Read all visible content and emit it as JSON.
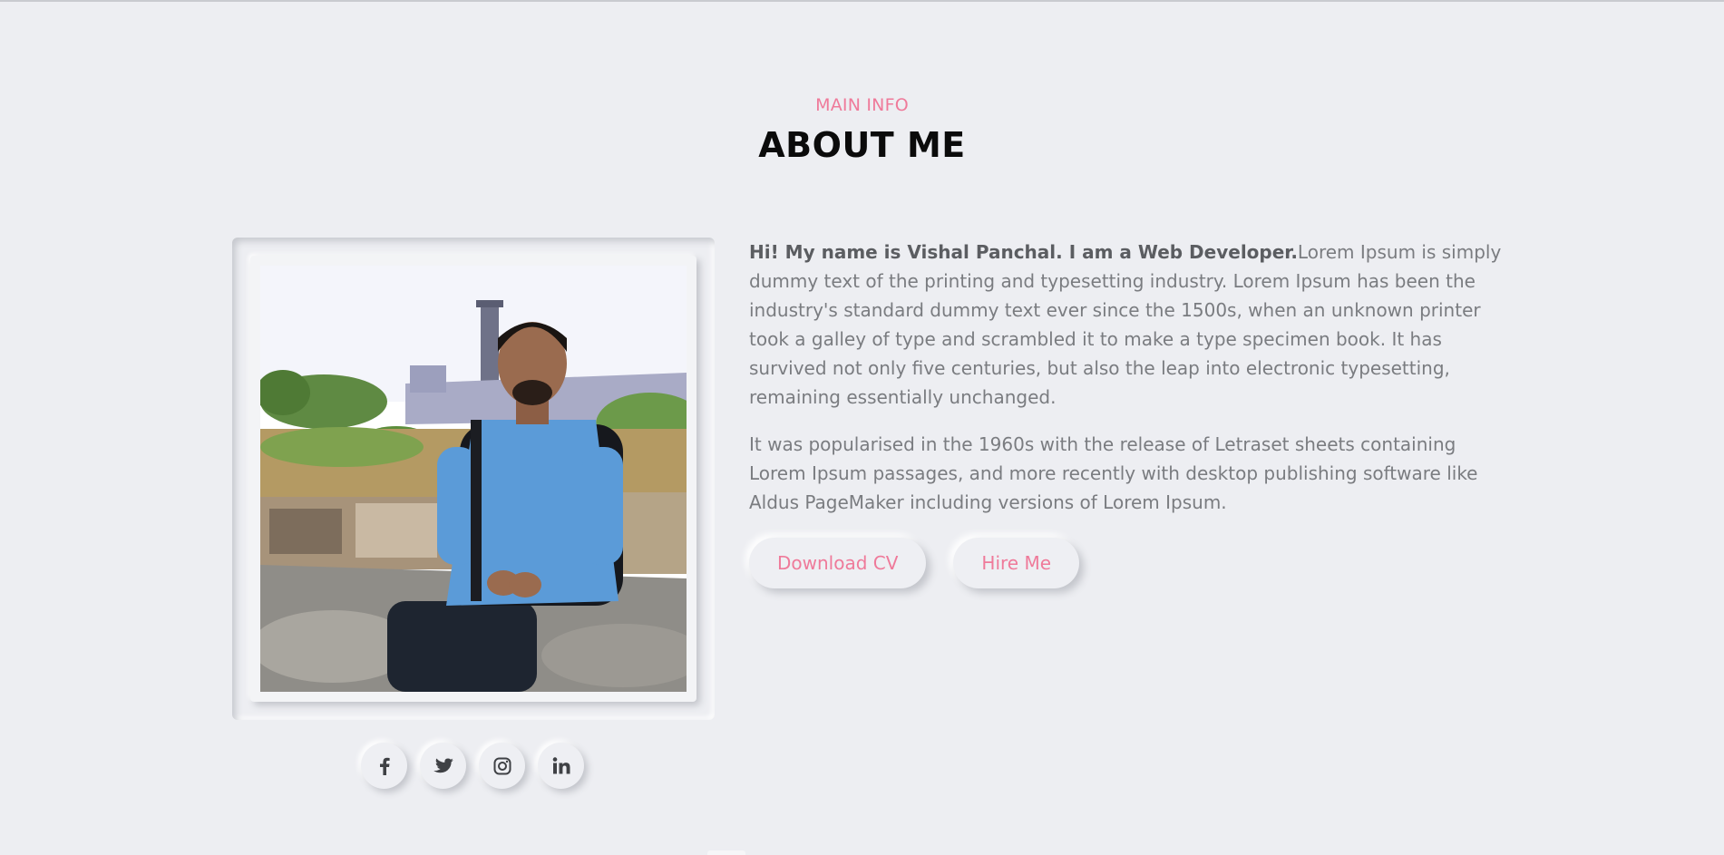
{
  "section": {
    "eyebrow": "MAIN INFO",
    "title": "ABOUT ME"
  },
  "about": {
    "intro_bold": "Hi! My name is Vishal Panchal. I am a Web Developer.",
    "intro_rest": "Lorem Ipsum is simply dummy text of the printing and typesetting industry. Lorem Ipsum has been the industry's standard dummy text ever since the 1500s, when an unknown printer took a galley of type and scrambled it to make a type specimen book. It has survived not only five centuries, but also the leap into electronic typesetting, remaining essentially unchanged.",
    "paragraph2": "It was popularised in the 1960s with the release of Letraset sheets containing Lorem Ipsum passages, and more recently with desktop publishing software like Aldus PageMaker including versions of Lorem Ipsum."
  },
  "buttons": {
    "download_label": "Download CV",
    "hire_label": "Hire Me"
  },
  "socials": [
    {
      "icon": "facebook-icon",
      "glyph": "f"
    },
    {
      "icon": "twitter-icon",
      "glyph": ""
    },
    {
      "icon": "instagram-icon",
      "glyph": ""
    },
    {
      "icon": "linkedin-icon",
      "glyph": "in"
    }
  ],
  "colors": {
    "background": "#edeef2",
    "accent": "#ef7a9a",
    "heading": "#0b0b0b",
    "body_text": "#7a7c80"
  }
}
